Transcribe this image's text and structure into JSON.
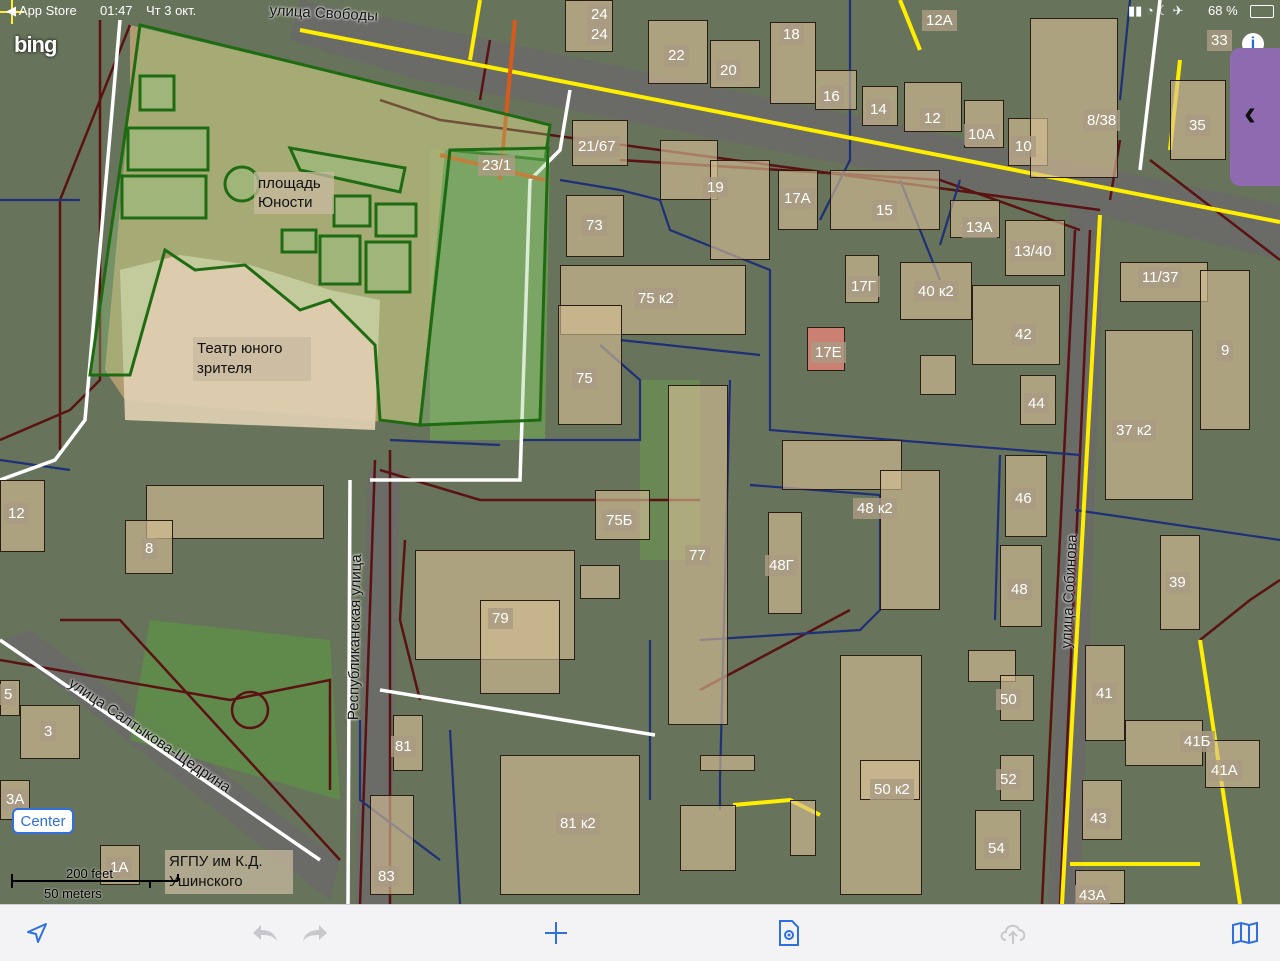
{
  "status_bar": {
    "back_app": "◀ App Store",
    "time": "01:47",
    "date": "Чт 3 окт.",
    "battery": "68 %"
  },
  "map": {
    "provider": "bing",
    "squares": [
      {
        "name": "площадь Юности"
      },
      {
        "name": "Театр юного зрителя"
      }
    ],
    "streets": {
      "svobody": "улица Свободы",
      "respublikanskaya": "Республиканская улица",
      "saltykova": "улица Салтыкова-Щедрина",
      "sobinova": "улица Собинова"
    },
    "poi": {
      "university": "ЯГПУ им К.Д. Ушинского"
    },
    "labels": {
      "24a": "24",
      "24b": "24",
      "18": "18",
      "12A_top": "12А",
      "33": "33",
      "22": "22",
      "20": "20",
      "16": "16",
      "14": "14",
      "12": "12",
      "10A": "10А",
      "10": "10",
      "8_38": "8/38",
      "35": "35",
      "21_67": "21/67",
      "23_1": "23/1",
      "19": "19",
      "17A": "17А",
      "15": "15",
      "13A": "13А",
      "13_40": "13/40",
      "73": "73",
      "75k2": "75 к2",
      "17G": "17Г",
      "40k2": "40 к2",
      "11_37": "11/37",
      "42": "42",
      "17E": "17Е",
      "9": "9",
      "75": "75",
      "44": "44",
      "37k2": "37 к2",
      "12_left": "12",
      "75B": "75Б",
      "48k2": "48 к2",
      "46": "46",
      "8": "8",
      "77": "77",
      "48G": "48Г",
      "48": "48",
      "39": "39",
      "79": "79",
      "41": "41",
      "5": "5",
      "3": "3",
      "50": "50",
      "81": "81",
      "41B": "41Б",
      "41A": "41А",
      "3A": "3А",
      "52": "52",
      "81k2": "81 к2",
      "50k2": "50 к2",
      "43": "43",
      "1A": "1А",
      "83": "83",
      "54": "54",
      "43A": "43А"
    }
  },
  "controls": {
    "center_label": "Center",
    "scale_feet": "200 feet",
    "scale_meters": "50 meters"
  },
  "toolbar": {
    "location": "location-arrow-icon",
    "undo": "undo-icon",
    "redo": "redo-icon",
    "add": "plus-icon",
    "settings": "document-gear-icon",
    "upload": "cloud-upload-icon",
    "layers": "map-book-icon"
  },
  "colors": {
    "main_road": "#ffee00",
    "pedestrian": "#ffffff",
    "water_pipe": "#1f2f78",
    "heating": "#5a1212",
    "square": "#1f6b12",
    "accent": "#2f6fe0"
  }
}
